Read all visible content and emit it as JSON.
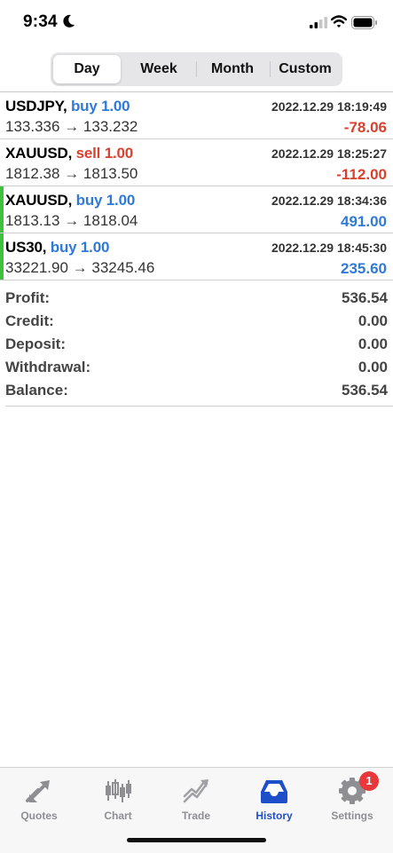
{
  "status_bar": {
    "time": "9:34"
  },
  "periods": [
    "Day",
    "Week",
    "Month",
    "Custom"
  ],
  "selected_period": "Day",
  "trades": [
    {
      "symbol": "USDJPY,",
      "side": "buy 1.00",
      "side_type": "buy",
      "time": "2022.12.29 18:19:49",
      "open": "133.336",
      "arrow": "→",
      "close": "133.232",
      "profit": "-78.06",
      "profit_sign": "neg",
      "accent": false
    },
    {
      "symbol": "XAUUSD,",
      "side": "sell 1.00",
      "side_type": "sell",
      "time": "2022.12.29 18:25:27",
      "open": "1812.38",
      "arrow": "→",
      "close": "1813.50",
      "profit": "-112.00",
      "profit_sign": "neg",
      "accent": false
    },
    {
      "symbol": "XAUUSD,",
      "side": "buy 1.00",
      "side_type": "buy",
      "time": "2022.12.29 18:34:36",
      "open": "1813.13",
      "arrow": "→",
      "close": "1818.04",
      "profit": "491.00",
      "profit_sign": "pos",
      "accent": true
    },
    {
      "symbol": "US30,",
      "side": "buy 1.00",
      "side_type": "buy",
      "time": "2022.12.29 18:45:30",
      "open": "33221.90",
      "arrow": "→",
      "close": "33245.46",
      "profit": "235.60",
      "profit_sign": "pos",
      "accent": true
    }
  ],
  "summary": [
    {
      "label": "Profit:",
      "value": "536.54"
    },
    {
      "label": "Credit:",
      "value": "0.00"
    },
    {
      "label": "Deposit:",
      "value": "0.00"
    },
    {
      "label": "Withdrawal:",
      "value": "0.00"
    },
    {
      "label": "Balance:",
      "value": "536.54"
    }
  ],
  "tabs": [
    {
      "label": "Quotes",
      "icon": "quotes-icon"
    },
    {
      "label": "Chart",
      "icon": "chart-icon"
    },
    {
      "label": "Trade",
      "icon": "trade-icon"
    },
    {
      "label": "History",
      "icon": "history-icon",
      "active": true
    },
    {
      "label": "Settings",
      "icon": "gear-icon",
      "badge": "1"
    }
  ],
  "colors": {
    "buy": "#2f7ad9",
    "sell": "#d9402e",
    "accent_bar": "#3ec23e",
    "tab_active": "#1f4fc8",
    "tab_inactive": "#8e8e93",
    "badge": "#e8383b"
  }
}
